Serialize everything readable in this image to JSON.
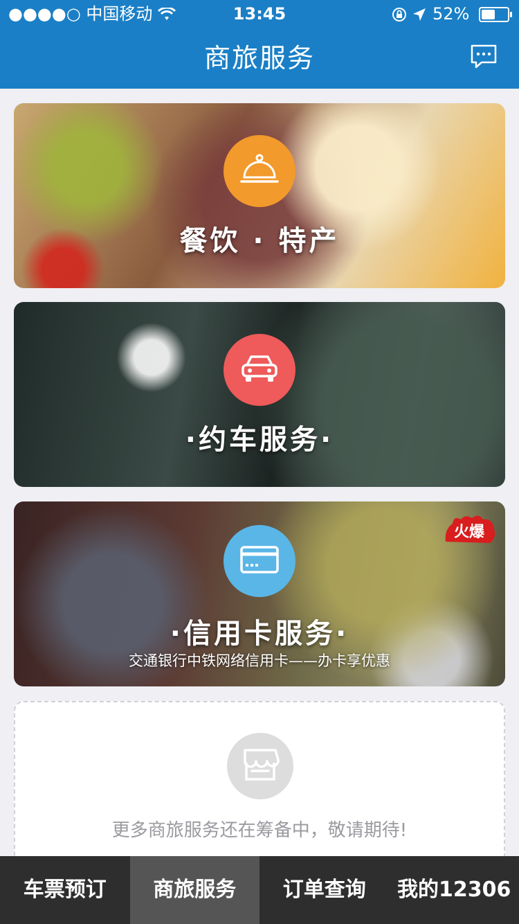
{
  "status_bar": {
    "signal": "●●●●○",
    "carrier": "中国移动",
    "time": "13:45",
    "battery": "52%",
    "battery_level": 0.52
  },
  "nav": {
    "title": "商旅服务",
    "message_icon": "chat-bubble-icon"
  },
  "cards": [
    {
      "title": "餐饮 · 特产",
      "icon": "food-cloche-icon",
      "icon_color": "#f39a2c"
    },
    {
      "title": "·约车服务·",
      "icon": "car-icon",
      "icon_color": "#ef5a5a"
    },
    {
      "title": "·信用卡服务·",
      "subtitle": "交通银行中铁网络信用卡——办卡享优惠",
      "badge": "火爆",
      "icon": "credit-card-icon",
      "icon_color": "#5ab6e6"
    }
  ],
  "placeholder": {
    "icon": "shop-icon",
    "text": "更多商旅服务还在筹备中，敬请期待!"
  },
  "tabs": [
    {
      "label": "车票预订",
      "active": false
    },
    {
      "label": "商旅服务",
      "active": true
    },
    {
      "label": "订单查询",
      "active": false
    },
    {
      "label": "我的12306",
      "active": false
    }
  ],
  "colors": {
    "nav_bg": "#1a7fc6",
    "tabbar_bg": "#2e2e2e",
    "tab_active_bg": "#555555",
    "page_bg": "#efeff4"
  }
}
